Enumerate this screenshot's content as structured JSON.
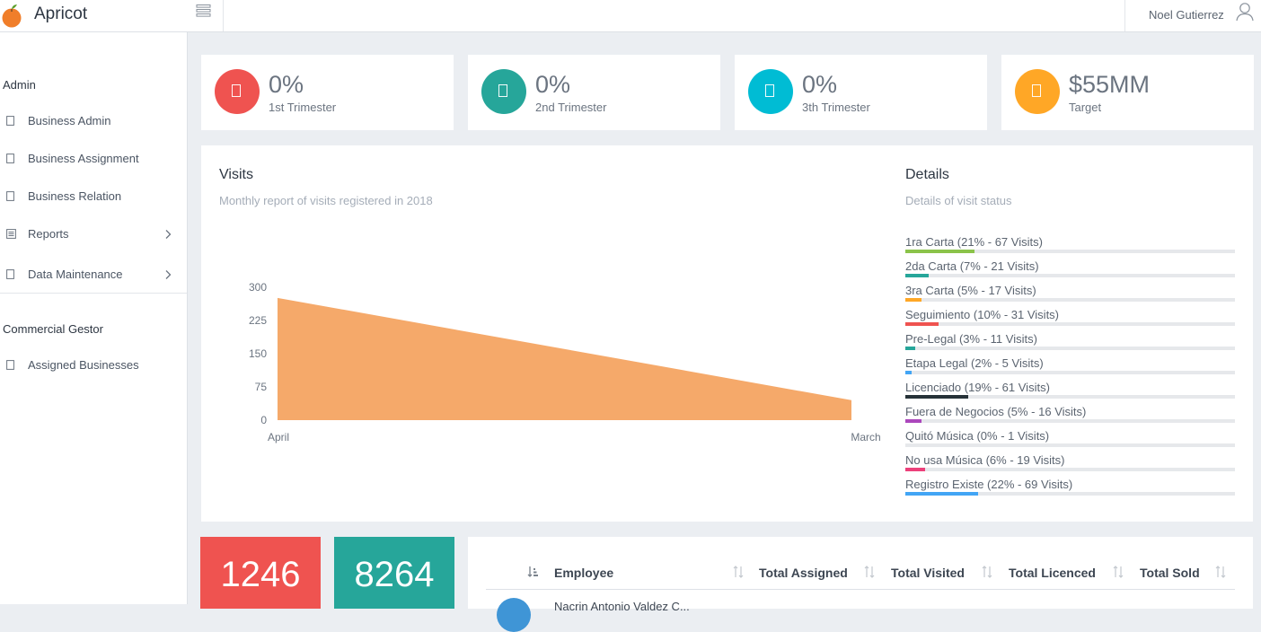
{
  "app": {
    "name": "Apricot",
    "user": "Noel Gutierrez"
  },
  "sidebar": {
    "sections": [
      {
        "title": "Admin",
        "items": [
          {
            "label": "Business Admin",
            "icon": "file-icon",
            "has_submenu": false
          },
          {
            "label": "Business Assignment",
            "icon": "file-icon",
            "has_submenu": false
          },
          {
            "label": "Business Relation",
            "icon": "file-icon",
            "has_submenu": false
          },
          {
            "label": "Reports",
            "icon": "list-icon",
            "has_submenu": true
          },
          {
            "label": "Data Maintenance",
            "icon": "file-icon",
            "has_submenu": true
          }
        ]
      },
      {
        "title": "Commercial Gestor",
        "items": [
          {
            "label": "Assigned Businesses",
            "icon": "file-icon",
            "has_submenu": false
          }
        ]
      }
    ]
  },
  "stats": [
    {
      "value": "0%",
      "label": "1st Trimester",
      "color": "#ef5350"
    },
    {
      "value": "0%",
      "label": "2nd Trimester",
      "color": "#26a69a"
    },
    {
      "value": "0%",
      "label": "3th Trimester",
      "color": "#00bcd4"
    },
    {
      "value": "$55MM",
      "label": "Target",
      "color": "#ffa726"
    }
  ],
  "visits": {
    "title": "Visits",
    "subtitle": "Monthly report of visits registered in 2018"
  },
  "chart_data": {
    "type": "area",
    "categories": [
      "April",
      "March"
    ],
    "series": [
      {
        "values": [
          276,
          45
        ],
        "color": "#f5a96a"
      }
    ],
    "ylim": [
      0,
      300
    ],
    "yticks": [
      0,
      75,
      150,
      225,
      300
    ],
    "grid": false
  },
  "details": {
    "title": "Details",
    "subtitle": "Details of visit status",
    "items": [
      {
        "label": "1ra Carta (21% - 67 Visits)",
        "percent": 21,
        "color": "#8bc34a"
      },
      {
        "label": "2da Carta (7% - 21 Visits)",
        "percent": 7,
        "color": "#26a69a"
      },
      {
        "label": "3ra Carta (5% - 17 Visits)",
        "percent": 5,
        "color": "#ffa726"
      },
      {
        "label": "Seguimiento (10% - 31 Visits)",
        "percent": 10,
        "color": "#ef5350"
      },
      {
        "label": "Pre-Legal (3% - 11 Visits)",
        "percent": 3,
        "color": "#26a69a"
      },
      {
        "label": "Etapa Legal (2% - 5 Visits)",
        "percent": 2,
        "color": "#42a5f5"
      },
      {
        "label": "Licenciado (19% - 61 Visits)",
        "percent": 19,
        "color": "#263238"
      },
      {
        "label": "Fuera de Negocios (5% - 16 Visits)",
        "percent": 5,
        "color": "#ab47bc"
      },
      {
        "label": "Quitó Música (0% - 1 Visits)",
        "percent": 0,
        "color": "#9e9e9e"
      },
      {
        "label": "No usa Música (6% - 19 Visits)",
        "percent": 6,
        "color": "#ec407a"
      },
      {
        "label": "Registro Existe (22% - 69 Visits)",
        "percent": 22,
        "color": "#42a5f5"
      }
    ]
  },
  "big_numbers": [
    {
      "value": "1246",
      "color": "#ef5350"
    },
    {
      "value": "8264",
      "color": "#26a69a"
    }
  ],
  "table": {
    "columns": [
      "Employee",
      "Total Assigned",
      "Total Visited",
      "Total Licenced",
      "Total Sold"
    ],
    "partial_row_text": "Nacrin Antonio Valdez C..."
  }
}
